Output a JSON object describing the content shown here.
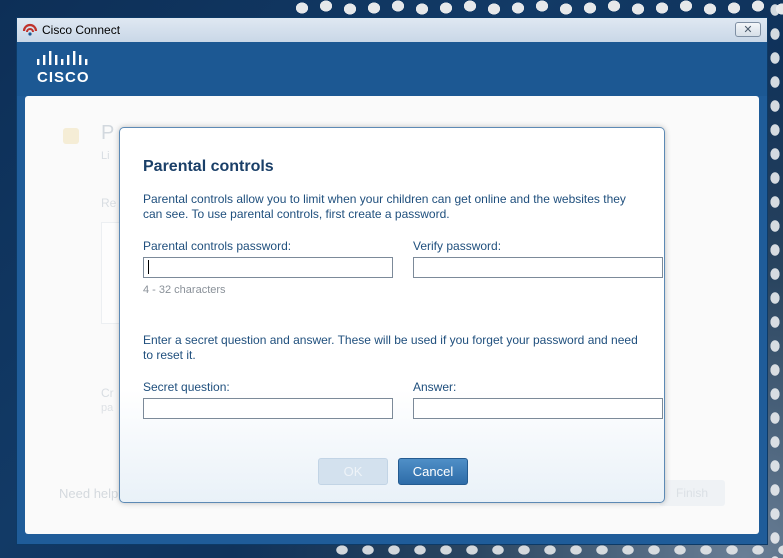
{
  "window": {
    "title": "Cisco Connect",
    "close_symbol": "✕",
    "icon": "cisco-connect-icon",
    "brand_logo_text": "CISCO"
  },
  "background": {
    "title": "P",
    "subtitle": "Li",
    "label1": "Re",
    "label2": "Cr",
    "label3": "pa",
    "help_text": "Need help",
    "button_label": "Finish"
  },
  "dialog": {
    "title": "Parental controls",
    "intro": "Parental controls allow you to limit when your children can get online and the websites they can see. To use parental controls, first create a password.",
    "password_label": "Parental controls password:",
    "password_value": "",
    "verify_label": "Verify password:",
    "verify_value": "",
    "password_hint": "4 - 32 characters",
    "secret_intro": "Enter a secret question and answer. These will be used if you forget your password and need to reset it.",
    "question_label": "Secret question:",
    "question_value": "",
    "answer_label": "Answer:",
    "answer_value": "",
    "ok_label": "OK",
    "cancel_label": "Cancel"
  },
  "colors": {
    "brand_blue": "#1c5893",
    "dialog_text": "#1f4f7d",
    "dialog_title": "#1a3f68",
    "primary_button": "#2e6ca8",
    "disabled_button": "#d3e1ee"
  }
}
